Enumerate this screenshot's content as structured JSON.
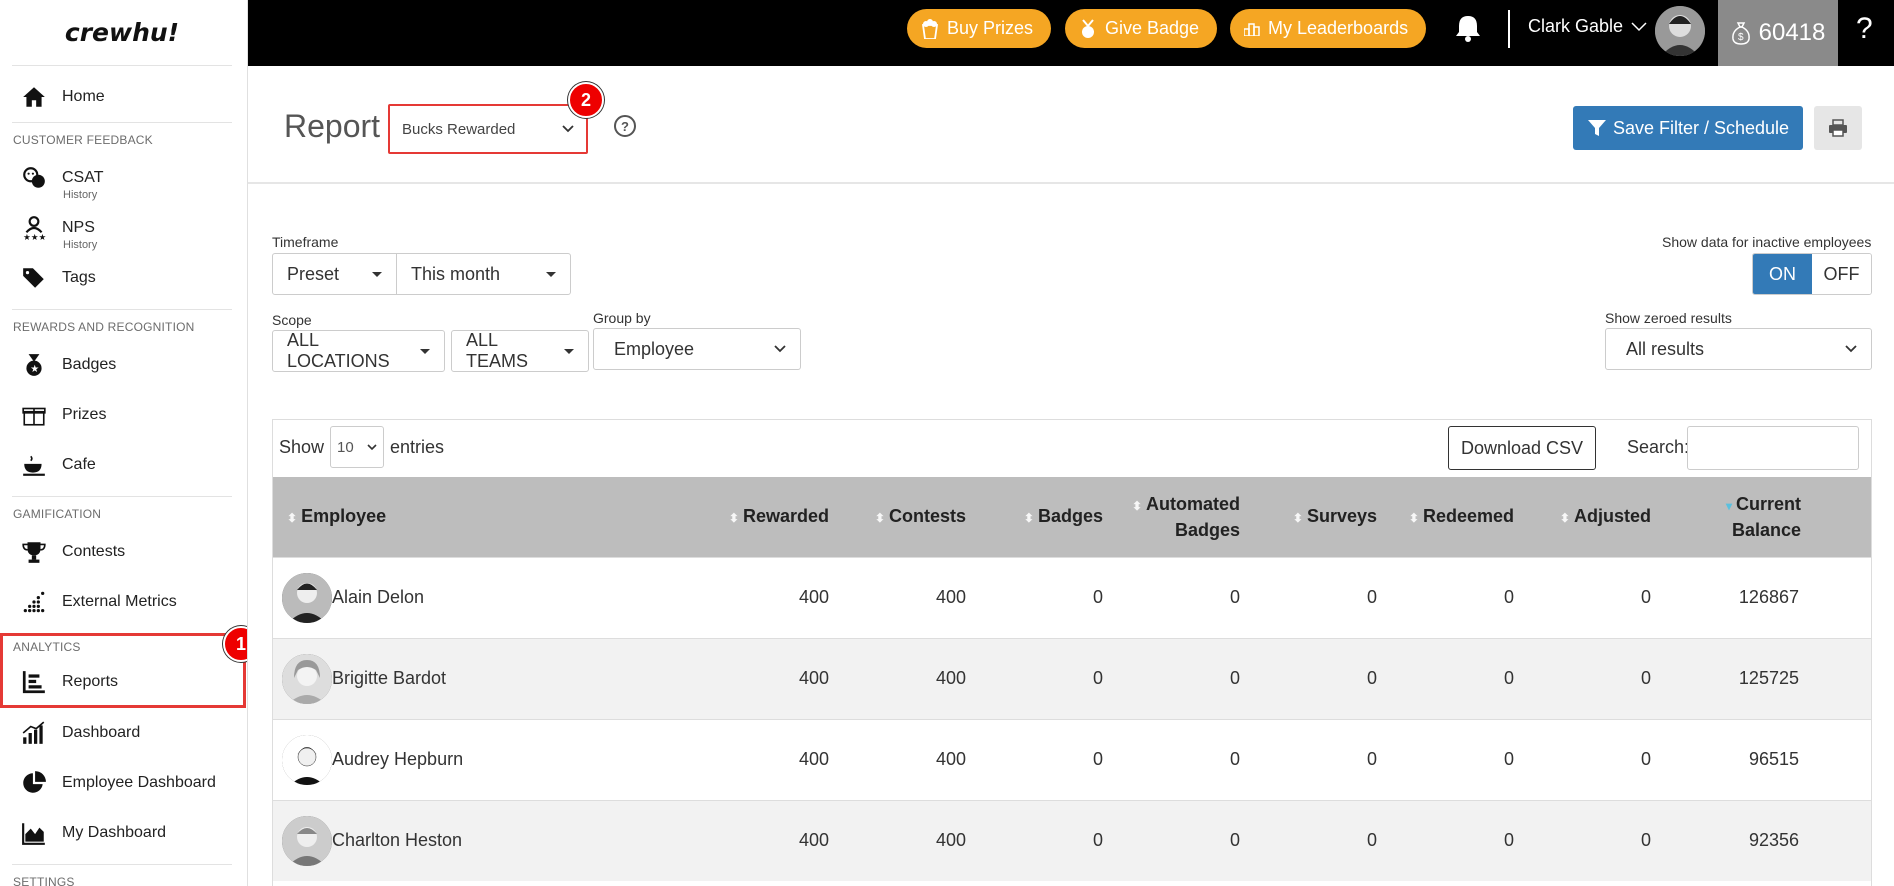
{
  "sidebar": {
    "logo": "crewhu!",
    "home": "Home",
    "sections": {
      "customer_feedback": "CUSTOMER FEEDBACK",
      "rewards": "REWARDS AND RECOGNITION",
      "gamification": "GAMIFICATION",
      "analytics": "ANALYTICS",
      "settings": "SETTINGS"
    },
    "csat": "CSAT",
    "csat_sub": "History",
    "nps": "NPS",
    "nps_sub": "History",
    "tags": "Tags",
    "badges": "Badges",
    "prizes": "Prizes",
    "cafe": "Cafe",
    "contests": "Contests",
    "external_metrics": "External Metrics",
    "reports": "Reports",
    "dashboard": "Dashboard",
    "employee_dashboard": "Employee Dashboard",
    "my_dashboard": "My Dashboard"
  },
  "topbar": {
    "buy_prizes": "Buy Prizes",
    "give_badge": "Give Badge",
    "my_leaderboards": "My Leaderboards",
    "username": "Clark Gable",
    "bucks": "60418",
    "help": "?"
  },
  "header": {
    "title": "Report",
    "report_type": "Bucks Rewarded",
    "save_filter": "Save Filter / Schedule"
  },
  "markers": {
    "one": "1",
    "two": "2"
  },
  "filters": {
    "timeframe_label": "Timeframe",
    "timeframe_preset": "Preset",
    "timeframe_value": "This month",
    "scope_label": "Scope",
    "locations": "ALL LOCATIONS",
    "teams": "ALL TEAMS",
    "groupby_label": "Group by",
    "groupby_value": "Employee",
    "inactive_label": "Show data for inactive employees",
    "on": "ON",
    "off": "OFF",
    "zeroed_label": "Show zeroed results",
    "zeroed_value": "All results"
  },
  "table_controls": {
    "show": "Show",
    "entries_value": "10",
    "entries": "entries",
    "download_csv": "Download CSV",
    "search": "Search:"
  },
  "table": {
    "headers": {
      "employee": "Employee",
      "rewarded": "Rewarded",
      "contests": "Contests",
      "badges": "Badges",
      "automated_1": "Automated",
      "automated_2": "Badges",
      "surveys": "Surveys",
      "redeemed": "Redeemed",
      "adjusted": "Adjusted",
      "balance_1": "Current",
      "balance_2": "Balance"
    },
    "rows": [
      {
        "name": "Alain Delon",
        "rewarded": "400",
        "contests": "400",
        "badges": "0",
        "automated": "0",
        "surveys": "0",
        "redeemed": "0",
        "adjusted": "0",
        "balance": "126867"
      },
      {
        "name": "Brigitte Bardot",
        "rewarded": "400",
        "contests": "400",
        "badges": "0",
        "automated": "0",
        "surveys": "0",
        "redeemed": "0",
        "adjusted": "0",
        "balance": "125725"
      },
      {
        "name": "Audrey Hepburn",
        "rewarded": "400",
        "contests": "400",
        "badges": "0",
        "automated": "0",
        "surveys": "0",
        "redeemed": "0",
        "adjusted": "0",
        "balance": "96515"
      },
      {
        "name": "Charlton Heston",
        "rewarded": "400",
        "contests": "400",
        "badges": "0",
        "automated": "0",
        "surveys": "0",
        "redeemed": "0",
        "adjusted": "0",
        "balance": "92356"
      }
    ]
  },
  "colors": {
    "accent": "#f5a623",
    "primary": "#337ab7",
    "highlight": "#e53935"
  }
}
